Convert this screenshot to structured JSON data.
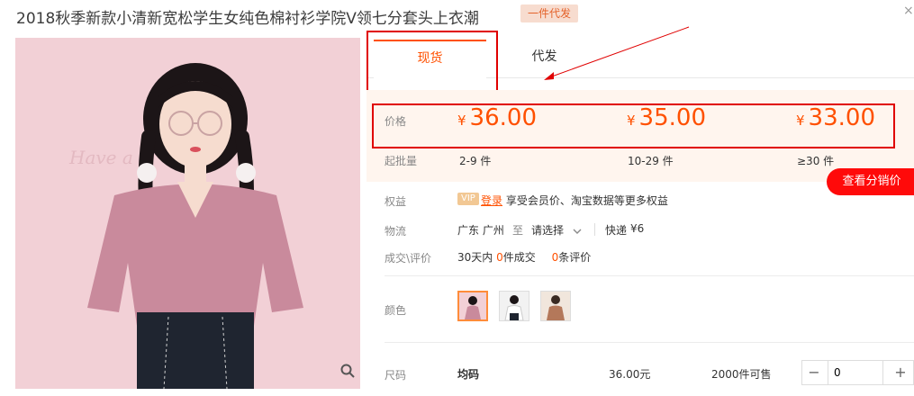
{
  "title": "2018秋季新款小清新宽松学生女纯色棉衬衫学院V领七分套头上衣潮",
  "badge": "一件代发",
  "close_glyph": "×",
  "tabs": [
    {
      "label": "现货",
      "active": true
    },
    {
      "label": "代发",
      "active": false
    }
  ],
  "price": {
    "label": "价格",
    "currency": "¥",
    "tiers": [
      {
        "value": "36.00",
        "qty": "2-9 件"
      },
      {
        "value": "35.00",
        "qty": "10-29 件"
      },
      {
        "value": "33.00",
        "qty": "≥30 件"
      }
    ],
    "min_batch_label": "起批量"
  },
  "distributor_button": "查看分销价",
  "benefits": {
    "label": "权益",
    "vip": "VIP",
    "login": "登录",
    "text": "享受会员价、淘宝数据等更多权益"
  },
  "logistics": {
    "label": "物流",
    "origin": "广东 广州",
    "to": "至",
    "destination": "请选择",
    "express": "快递",
    "fee": "¥6"
  },
  "deals": {
    "label": "成交\\评价",
    "period": "30天内",
    "deal_count": "0",
    "deal_suffix": "件成交",
    "review_count": "0",
    "review_suffix": "条评价"
  },
  "color": {
    "label": "颜色",
    "swatches": [
      "pink-top",
      "white-top",
      "brown-top"
    ]
  },
  "size_row": {
    "label": "尺码",
    "size": "均码",
    "price": "36.00元",
    "stock": "2000件可售",
    "quantity": "0",
    "minus": "−",
    "plus": "+"
  },
  "colors": {
    "accent": "#ff5000",
    "annotation": "#e00000",
    "price_bg": "#fff5ee",
    "button_red": "#ff0a0a"
  },
  "icons": [
    "zoom-icon",
    "chevron-down-icon",
    "close-icon"
  ]
}
